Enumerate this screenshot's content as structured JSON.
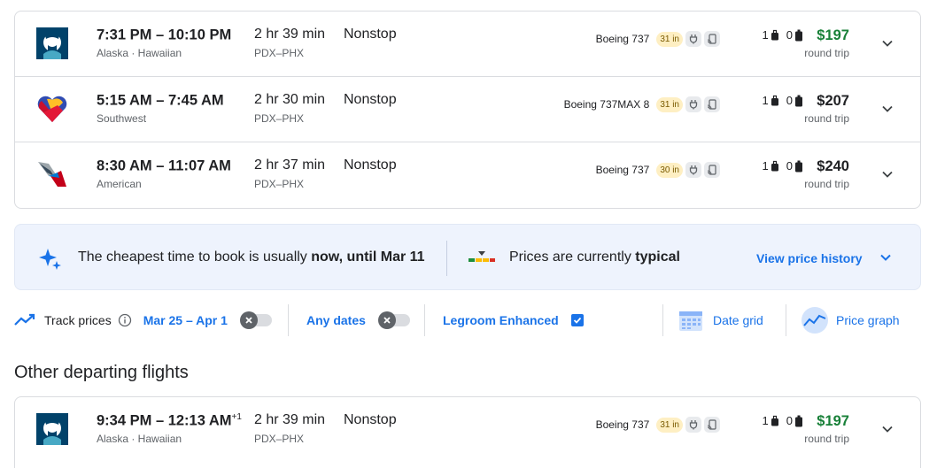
{
  "top_flights": [
    {
      "logo": "alaska-logo",
      "times": "7:31 PM – 10:10 PM",
      "day_offset": "",
      "airline": "Alaska · Hawaiian",
      "duration": "2 hr 39 min",
      "route": "PDX–PHX",
      "stops": "Nonstop",
      "aircraft": "Boeing 737",
      "legroom": "31 in",
      "carry_on": "1",
      "checked": "0",
      "price": "$197",
      "price_color": "#188038",
      "price_note": "round trip"
    },
    {
      "logo": "southwest-logo",
      "times": "5:15 AM – 7:45 AM",
      "day_offset": "",
      "airline": "Southwest",
      "duration": "2 hr 30 min",
      "route": "PDX–PHX",
      "stops": "Nonstop",
      "aircraft": "Boeing 737MAX 8",
      "legroom": "31 in",
      "carry_on": "1",
      "checked": "0",
      "price": "$207",
      "price_color": "#202124",
      "price_note": "round trip"
    },
    {
      "logo": "american-logo",
      "times": "8:30 AM – 11:07 AM",
      "day_offset": "",
      "airline": "American",
      "duration": "2 hr 37 min",
      "route": "PDX–PHX",
      "stops": "Nonstop",
      "aircraft": "Boeing 737",
      "legroom": "30 in",
      "carry_on": "1",
      "checked": "0",
      "price": "$240",
      "price_color": "#202124",
      "price_note": "round trip"
    }
  ],
  "insights": {
    "cheapest_prefix": "The cheapest time to book is usually ",
    "cheapest_bold": "now, until Mar 11",
    "typical_prefix": "Prices are currently ",
    "typical_bold": "typical",
    "history_link": "View price history"
  },
  "toolbar": {
    "track_prices": "Track prices",
    "date_range": "Mar 25 – Apr 1",
    "any_dates": "Any dates",
    "legroom_enhanced": "Legroom Enhanced",
    "date_grid": "Date grid",
    "price_graph": "Price graph"
  },
  "other_title": "Other departing flights",
  "other_flights": [
    {
      "logo": "alaska-logo",
      "times": "9:34 PM – 12:13 AM",
      "day_offset": "+1",
      "airline": "Alaska · Hawaiian",
      "duration": "2 hr 39 min",
      "route": "PDX–PHX",
      "stops": "Nonstop",
      "aircraft": "Boeing 737",
      "legroom": "31 in",
      "carry_on": "1",
      "checked": "0",
      "price": "$197",
      "price_color": "#188038",
      "price_note": "round trip"
    }
  ]
}
